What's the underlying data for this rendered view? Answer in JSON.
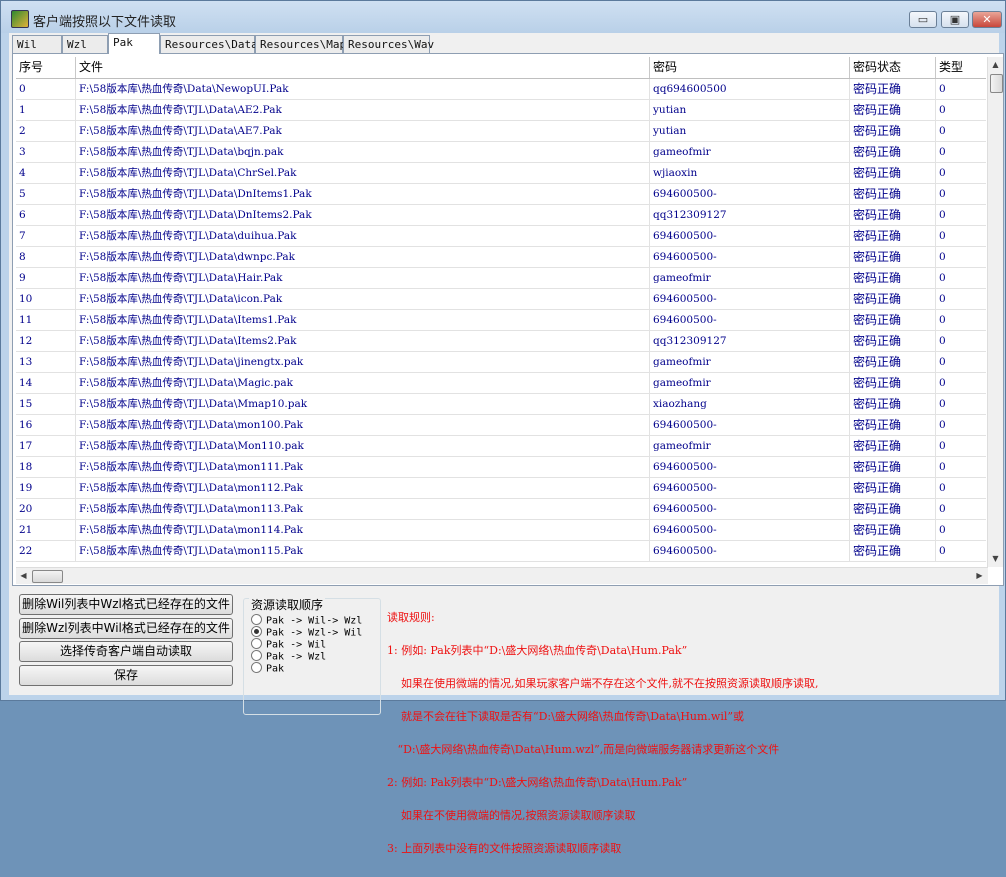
{
  "window": {
    "title": "客户端按照以下文件读取",
    "min_label": "▭",
    "max_label": "▣",
    "close_label": "✕"
  },
  "tabs": [
    "Wil",
    "Wzl",
    "Pak",
    "Resources\\Data",
    "Resources\\Map",
    "Resources\\Wav"
  ],
  "active_tab": 2,
  "table": {
    "columns": [
      "序号",
      "文件",
      "密码",
      "密码状态",
      "类型"
    ],
    "rows": [
      [
        "0",
        "F:\\58版本库\\热血传奇\\Data\\NewopUI.Pak",
        "qq694600500",
        "密码正确",
        "0"
      ],
      [
        "1",
        "F:\\58版本库\\热血传奇\\TJL\\Data\\AE2.Pak",
        "yutian",
        "密码正确",
        "0"
      ],
      [
        "2",
        "F:\\58版本库\\热血传奇\\TJL\\Data\\AE7.Pak",
        "yutian",
        "密码正确",
        "0"
      ],
      [
        "3",
        "F:\\58版本库\\热血传奇\\TJL\\Data\\bqjn.pak",
        "gameofmir",
        "密码正确",
        "0"
      ],
      [
        "4",
        "F:\\58版本库\\热血传奇\\TJL\\Data\\ChrSel.Pak",
        "wjiaoxin",
        "密码正确",
        "0"
      ],
      [
        "5",
        "F:\\58版本库\\热血传奇\\TJL\\Data\\DnItems1.Pak",
        "694600500-",
        "密码正确",
        "0"
      ],
      [
        "6",
        "F:\\58版本库\\热血传奇\\TJL\\Data\\DnItems2.Pak",
        "qq312309127",
        "密码正确",
        "0"
      ],
      [
        "7",
        "F:\\58版本库\\热血传奇\\TJL\\Data\\duihua.Pak",
        "694600500-",
        "密码正确",
        "0"
      ],
      [
        "8",
        "F:\\58版本库\\热血传奇\\TJL\\Data\\dwnpc.Pak",
        "694600500-",
        "密码正确",
        "0"
      ],
      [
        "9",
        "F:\\58版本库\\热血传奇\\TJL\\Data\\Hair.Pak",
        "gameofmir",
        "密码正确",
        "0"
      ],
      [
        "10",
        "F:\\58版本库\\热血传奇\\TJL\\Data\\icon.Pak",
        "694600500-",
        "密码正确",
        "0"
      ],
      [
        "11",
        "F:\\58版本库\\热血传奇\\TJL\\Data\\Items1.Pak",
        "694600500-",
        "密码正确",
        "0"
      ],
      [
        "12",
        "F:\\58版本库\\热血传奇\\TJL\\Data\\Items2.Pak",
        "qq312309127",
        "密码正确",
        "0"
      ],
      [
        "13",
        "F:\\58版本库\\热血传奇\\TJL\\Data\\jinengtx.pak",
        "gameofmir",
        "密码正确",
        "0"
      ],
      [
        "14",
        "F:\\58版本库\\热血传奇\\TJL\\Data\\Magic.pak",
        "gameofmir",
        "密码正确",
        "0"
      ],
      [
        "15",
        "F:\\58版本库\\热血传奇\\TJL\\Data\\Mmap10.pak",
        "xiaozhang",
        "密码正确",
        "0"
      ],
      [
        "16",
        "F:\\58版本库\\热血传奇\\TJL\\Data\\mon100.Pak",
        "694600500-",
        "密码正确",
        "0"
      ],
      [
        "17",
        "F:\\58版本库\\热血传奇\\TJL\\Data\\Mon110.pak",
        "gameofmir",
        "密码正确",
        "0"
      ],
      [
        "18",
        "F:\\58版本库\\热血传奇\\TJL\\Data\\mon111.Pak",
        "694600500-",
        "密码正确",
        "0"
      ],
      [
        "19",
        "F:\\58版本库\\热血传奇\\TJL\\Data\\mon112.Pak",
        "694600500-",
        "密码正确",
        "0"
      ],
      [
        "20",
        "F:\\58版本库\\热血传奇\\TJL\\Data\\mon113.Pak",
        "694600500-",
        "密码正确",
        "0"
      ],
      [
        "21",
        "F:\\58版本库\\热血传奇\\TJL\\Data\\mon114.Pak",
        "694600500-",
        "密码正确",
        "0"
      ],
      [
        "22",
        "F:\\58版本库\\热血传奇\\TJL\\Data\\mon115.Pak",
        "694600500-",
        "密码正确",
        "0"
      ]
    ]
  },
  "buttons": {
    "delete_wil": "删除Wil列表中Wzl格式已经存在的文件",
    "delete_wzl": "删除Wzl列表中Wil格式已经存在的文件",
    "select_client": "选择传奇客户端自动读取",
    "save": "保存"
  },
  "resource_order": {
    "title": "资源读取顺序",
    "options": [
      "Pak -> Wil-> Wzl",
      "Pak -> Wzl-> Wil",
      "Pak -> Wil",
      "Pak -> Wzl",
      "Pak"
    ],
    "selected": 1
  },
  "rules": {
    "lines": [
      "读取规则:",
      "1: 例如: Pak列表中“D:\\盛大网络\\热血传奇\\Data\\Hum.Pak”",
      "    如果在使用微端的情况,如果玩家客户端不存在这个文件,就不在按照资源读取顺序读取,",
      "    就是不会在往下读取是否有“D:\\盛大网络\\热血传奇\\Data\\Hum.wil”或",
      "   “D:\\盛大网络\\热血传奇\\Data\\Hum.wzl”,而是向微端服务器请求更新这个文件",
      "2: 例如: Pak列表中“D:\\盛大网络\\热血传奇\\Data\\Hum.Pak”",
      "    如果在不使用微端的情况,按照资源读取顺序读取",
      "3: 上面列表中没有的文件按照资源读取顺序读取"
    ]
  }
}
